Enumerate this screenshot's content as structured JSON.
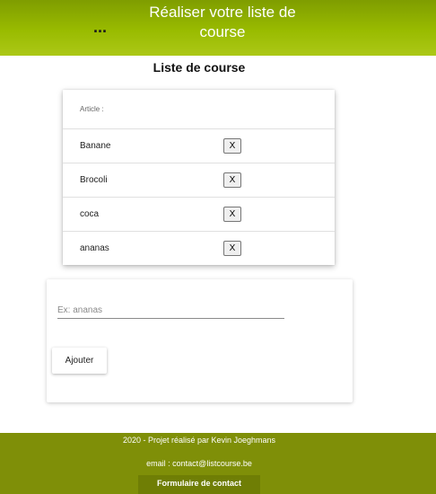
{
  "header": {
    "menu_icon": "...",
    "title": "Réaliser votre liste de course"
  },
  "page_title": "Liste de course",
  "list": {
    "header_label": "Article :",
    "items": [
      {
        "label": "Banane",
        "delete_label": "X"
      },
      {
        "label": "Brocoli",
        "delete_label": "X"
      },
      {
        "label": "coca",
        "delete_label": "X"
      },
      {
        "label": "ananas",
        "delete_label": "X"
      }
    ]
  },
  "form": {
    "input_placeholder": "Ex: ananas",
    "input_value": "",
    "add_label": "Ajouter"
  },
  "footer": {
    "credit": "2020 - Projet réalisé par Kevin Joeghmans",
    "email": "email : contact@listcourse.be",
    "contact_button": "Formulaire de contact"
  },
  "colors": {
    "header_top": "#7f9d00",
    "header_bottom": "#acc817",
    "footer": "#7f8f08"
  }
}
